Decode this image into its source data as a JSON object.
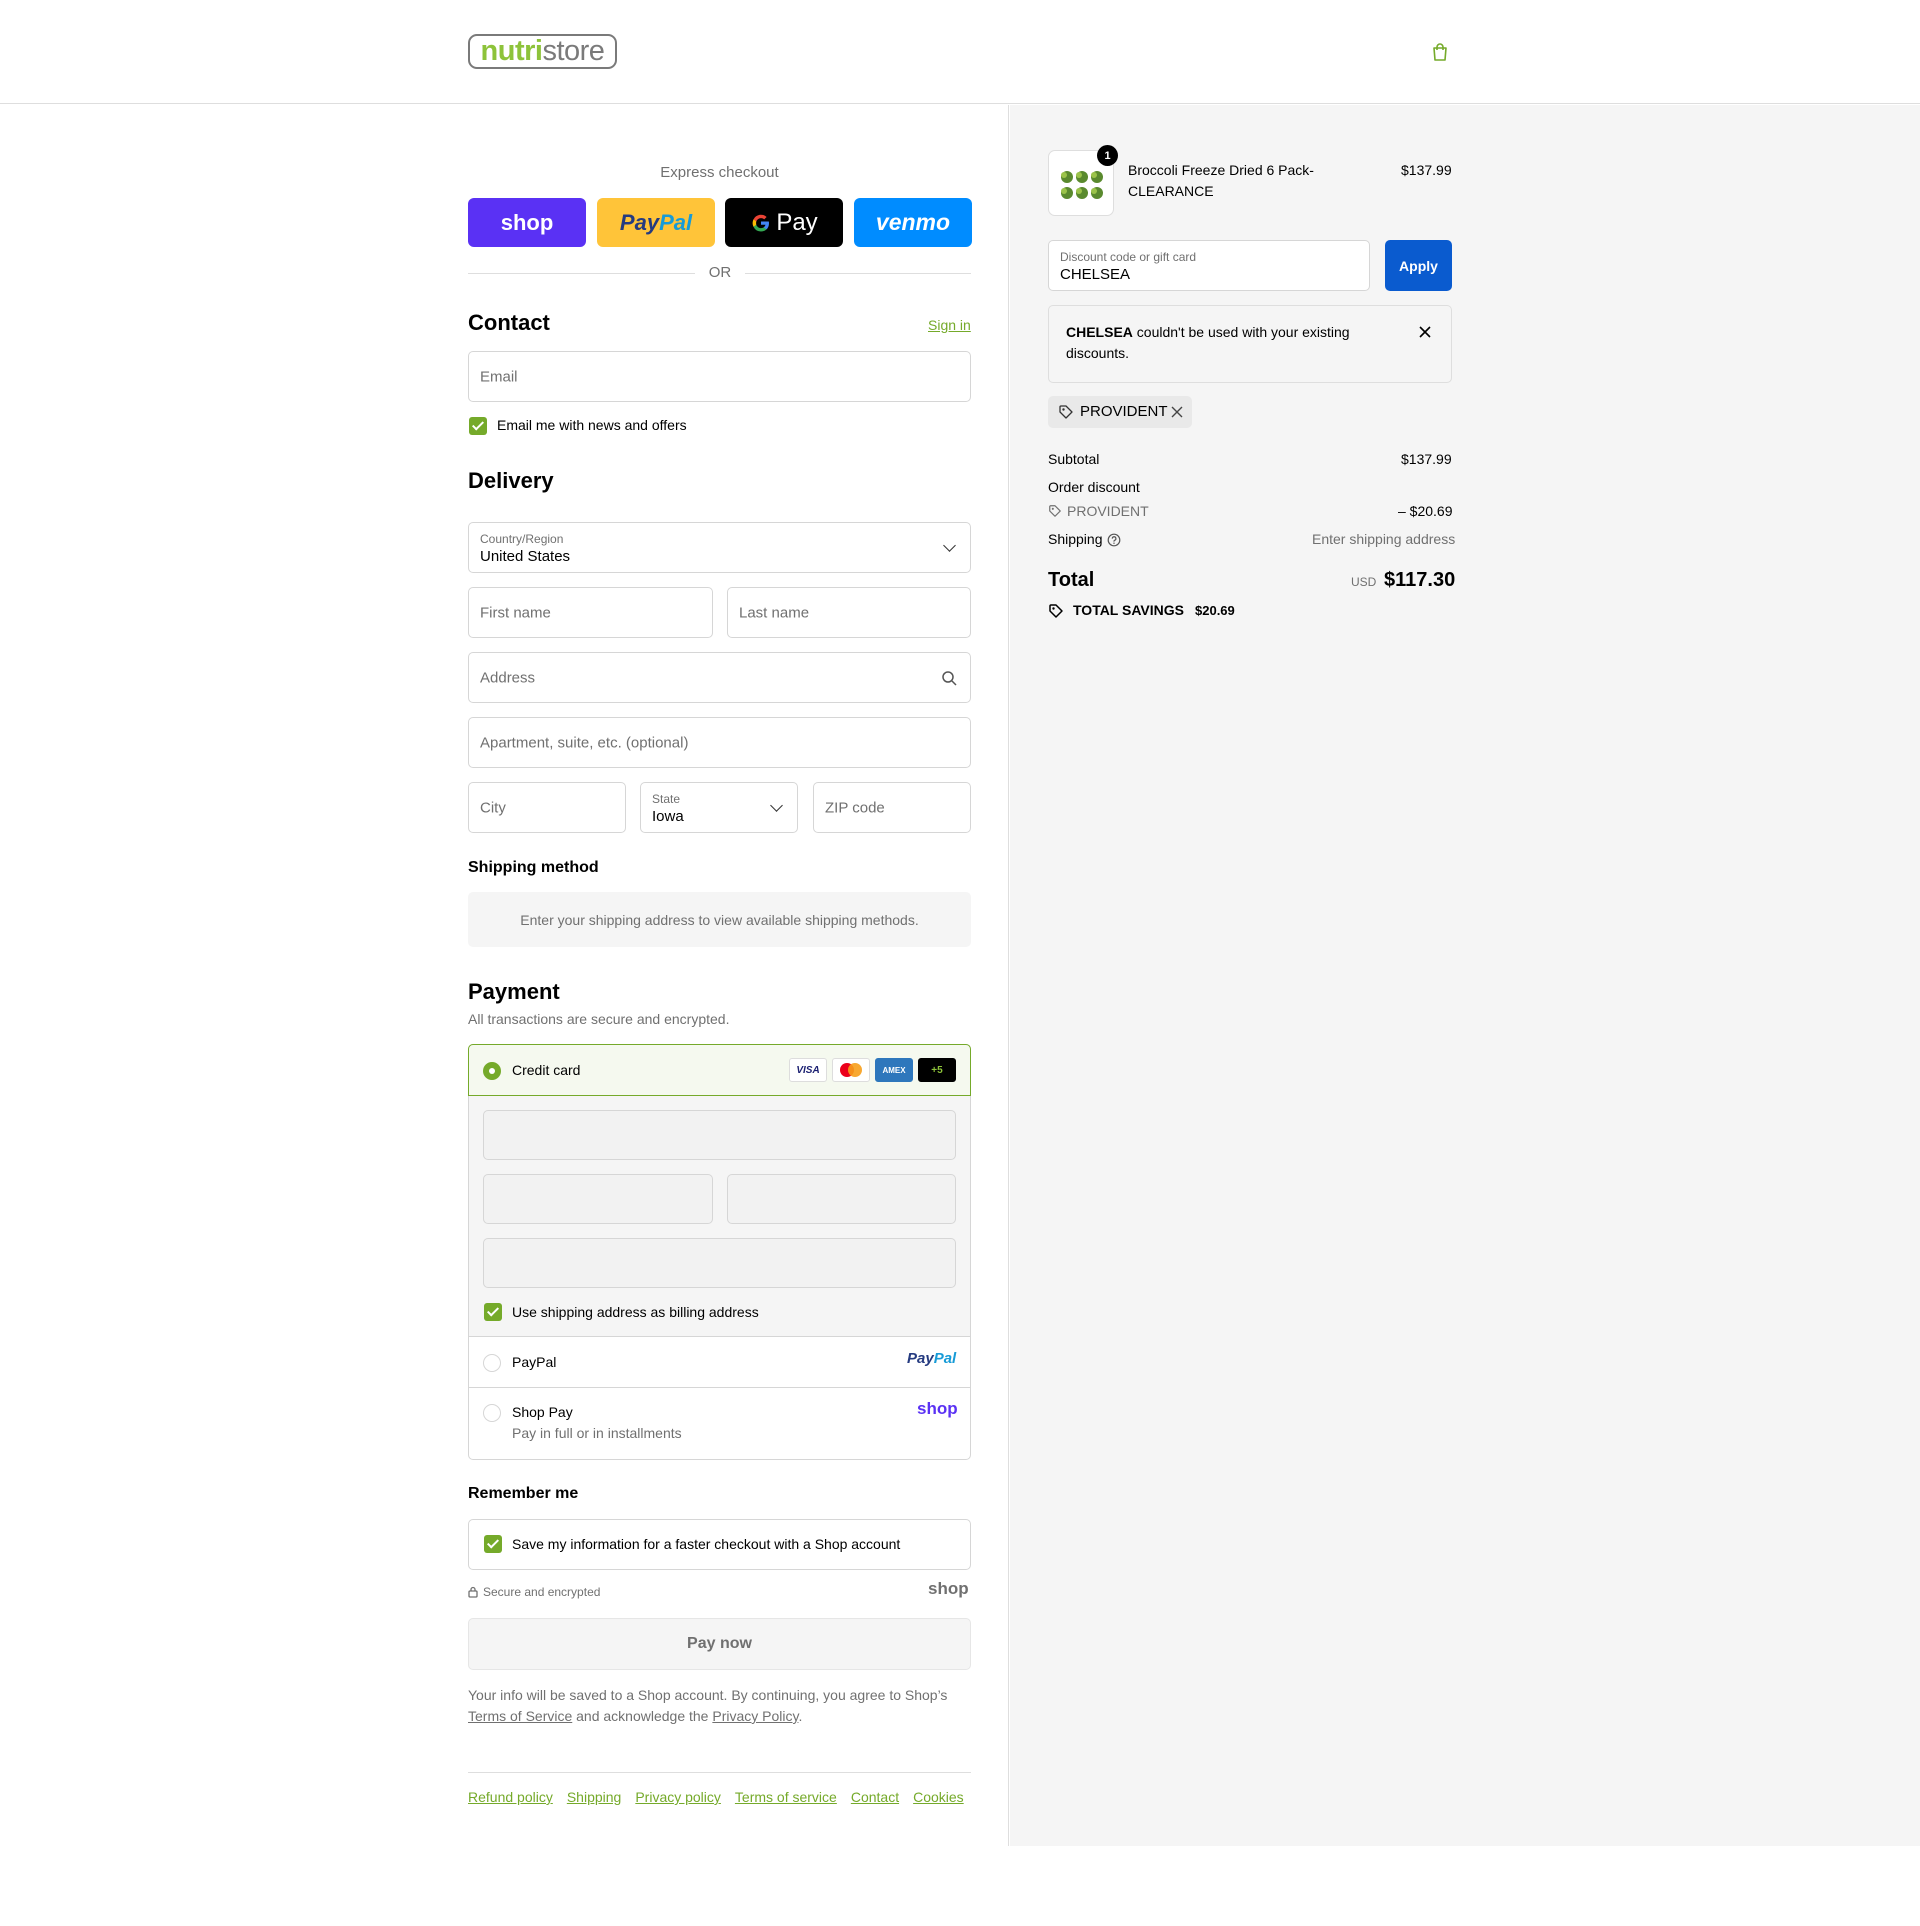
{
  "header": {
    "logo_part1": "nutri",
    "logo_part2": "store",
    "cart_icon": "shopping-bag-icon"
  },
  "express": {
    "title": "Express checkout",
    "buttons": [
      "shop",
      "PayPal",
      "G Pay",
      "venmo"
    ],
    "or": "OR"
  },
  "contact": {
    "title": "Contact",
    "sign_in": "Sign in",
    "email_placeholder": "Email",
    "newsletter": "Email me with news and offers"
  },
  "delivery": {
    "title": "Delivery",
    "country_label": "Country/Region",
    "country_value": "United States",
    "first_name": "First name",
    "last_name": "Last name",
    "address": "Address",
    "apartment": "Apartment, suite, etc. (optional)",
    "city": "City",
    "state_label": "State",
    "state_value": "Iowa",
    "zip": "ZIP code"
  },
  "shipping_method": {
    "title": "Shipping method",
    "message": "Enter your shipping address to view available shipping methods."
  },
  "payment": {
    "title": "Payment",
    "subtitle": "All transactions are secure and encrypted.",
    "credit_card": "Credit card",
    "card_logos": [
      "VISA",
      "MC",
      "AMEX",
      "+5"
    ],
    "billing_same": "Use shipping address as billing address",
    "paypal": "PayPal",
    "paypal_logo": "PayPal",
    "shop_pay": "Shop Pay",
    "shop_pay_sub": "Pay in full or in installments",
    "shop_logo": "shop"
  },
  "remember": {
    "title": "Remember me",
    "save": "Save my information for a faster checkout with a Shop account",
    "secure": "Secure and encrypted",
    "shop_logo": "shop"
  },
  "pay_now": "Pay now",
  "legal": {
    "part1": "Your info will be saved to a Shop account. By continuing, you agree to Shop’s",
    "terms": "Terms of Service",
    "part2": "and acknowledge the",
    "privacy": "Privacy Policy",
    "end": "."
  },
  "footer_links": [
    "Refund policy",
    "Shipping",
    "Privacy policy",
    "Terms of service",
    "Contact",
    "Cookies"
  ],
  "summary": {
    "product": {
      "qty": "1",
      "name_line1": "Broccoli Freeze Dried 6 Pack-",
      "name_line2": "CLEARANCE",
      "price": "$137.99"
    },
    "discount_label": "Discount code or gift card",
    "discount_value": "CHELSEA",
    "apply": "Apply",
    "error_code": "CHELSEA",
    "error_line1": " couldn't be used with your existing",
    "error_line2": "discounts.",
    "applied_code": "PROVIDENT",
    "subtotal_label": "Subtotal",
    "subtotal_value": "$137.99",
    "order_discount_label": "Order discount",
    "order_discount_code": "PROVIDENT",
    "order_discount_value": "– $20.69",
    "shipping_label": "Shipping",
    "shipping_value": "Enter shipping address",
    "total_label": "Total",
    "currency": "USD",
    "total_value": "$117.30",
    "savings_label": "TOTAL SAVINGS",
    "savings_value": "$20.69"
  },
  "colors": {
    "accent": "#75aa2a",
    "apply_button": "#0a5bcf",
    "shop_purple": "#5a31f4",
    "paypal_yellow": "#ffc439",
    "venmo_blue": "#008cff"
  }
}
